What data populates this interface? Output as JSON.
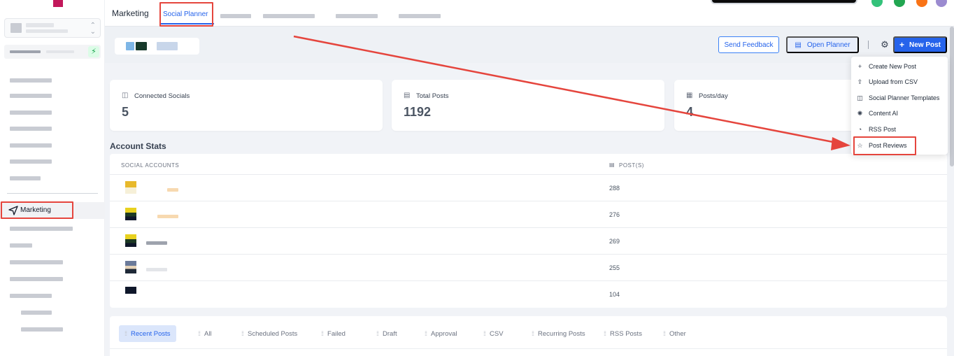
{
  "topbar": {
    "title": "Marketing",
    "tab_active": "Social Planner"
  },
  "sidebar": {
    "marketing_label": "Marketing"
  },
  "toolbar": {
    "send_feedback": "Send Feedback",
    "open_planner": "Open Planner",
    "new_post": "New Post"
  },
  "stats": {
    "connected_socials": {
      "label": "Connected Socials",
      "value": "5"
    },
    "total_posts": {
      "label": "Total Posts",
      "value": "1192"
    },
    "posts_per_day": {
      "label": "Posts/day",
      "value": "4"
    }
  },
  "account_stats": {
    "title": "Account Stats",
    "col_accounts": "SOCIAL ACCOUNTS",
    "col_posts": "POST(S)",
    "rows": [
      {
        "posts": "288"
      },
      {
        "posts": "276"
      },
      {
        "posts": "269"
      },
      {
        "posts": "255"
      },
      {
        "posts": "104"
      }
    ]
  },
  "post_tabs": [
    "Recent Posts",
    "All",
    "Scheduled Posts",
    "Failed",
    "Draft",
    "Approval",
    "CSV",
    "Recurring Posts",
    "RSS Posts",
    "Other"
  ],
  "new_post_menu": [
    {
      "label": "Create New Post",
      "icon": "plus-icon"
    },
    {
      "label": "Upload from CSV",
      "icon": "upload-icon"
    },
    {
      "label": "Social Planner Templates",
      "icon": "template-icon"
    },
    {
      "label": "Content AI",
      "icon": "ai-icon"
    },
    {
      "label": "RSS Post",
      "icon": "rss-icon"
    },
    {
      "label": "Post Reviews",
      "icon": "star-icon"
    }
  ],
  "colors": {
    "accent": "#2563eb",
    "annotation": "#e5453d"
  }
}
